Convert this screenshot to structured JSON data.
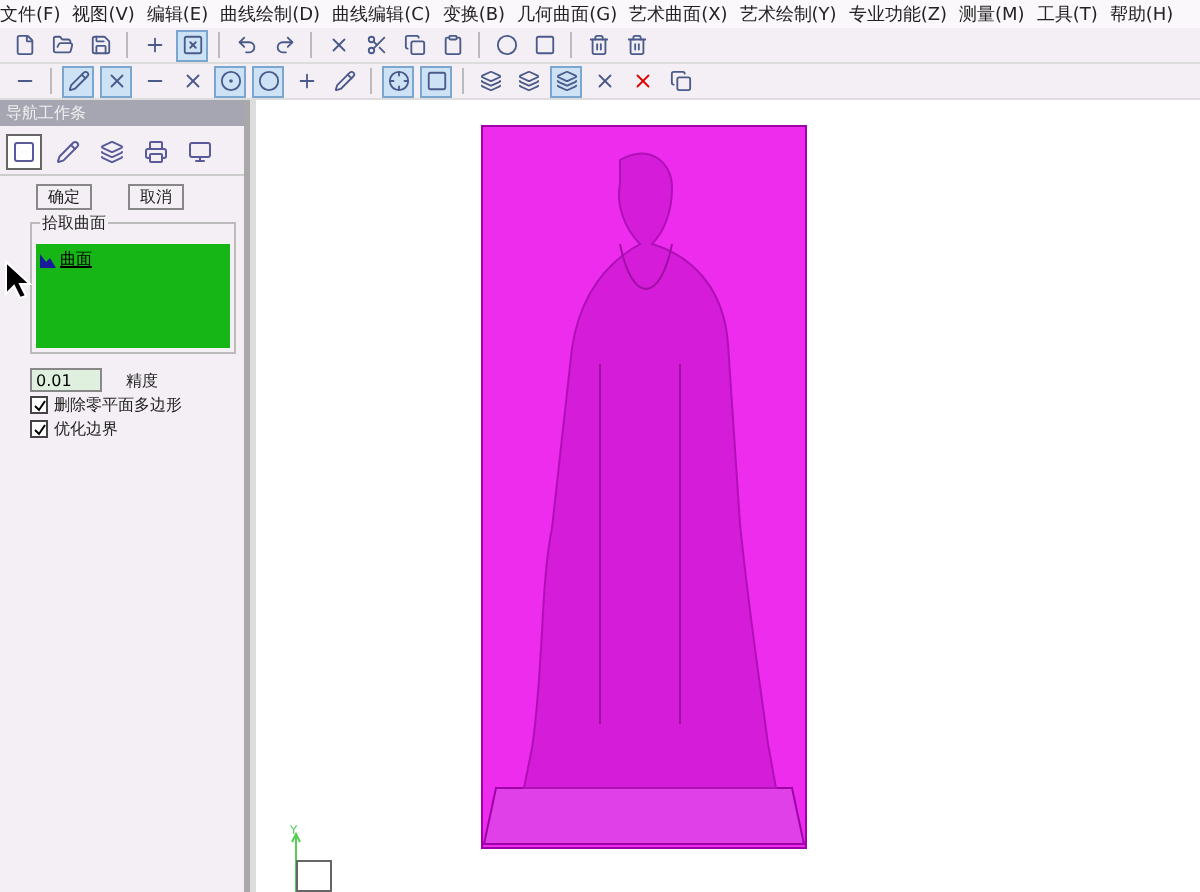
{
  "menu": [
    "文件(F)",
    "视图(V)",
    "编辑(E)",
    "曲线绘制(D)",
    "曲线编辑(C)",
    "变换(B)",
    "几何曲面(G)",
    "艺术曲面(X)",
    "艺术绘制(Y)",
    "专业功能(Z)",
    "测量(M)",
    "工具(T)",
    "帮助(H)"
  ],
  "panel": {
    "title": "导航工作条",
    "tabs": [
      {
        "selected": true
      },
      {
        "selected": false
      },
      {
        "selected": false
      },
      {
        "selected": false
      },
      {
        "selected": false
      }
    ],
    "buttons": [
      "确定",
      "取消"
    ],
    "group_label": "拾取曲面",
    "list": [
      {
        "label": "曲面",
        "selected": true
      }
    ],
    "precision": {
      "value": "0.01",
      "label": "精度"
    },
    "options": [
      {
        "label": "删除零平面多边形",
        "checked": true
      },
      {
        "label": "优化边界",
        "checked": true
      }
    ]
  },
  "viewport": {
    "axis_label": "Y"
  }
}
